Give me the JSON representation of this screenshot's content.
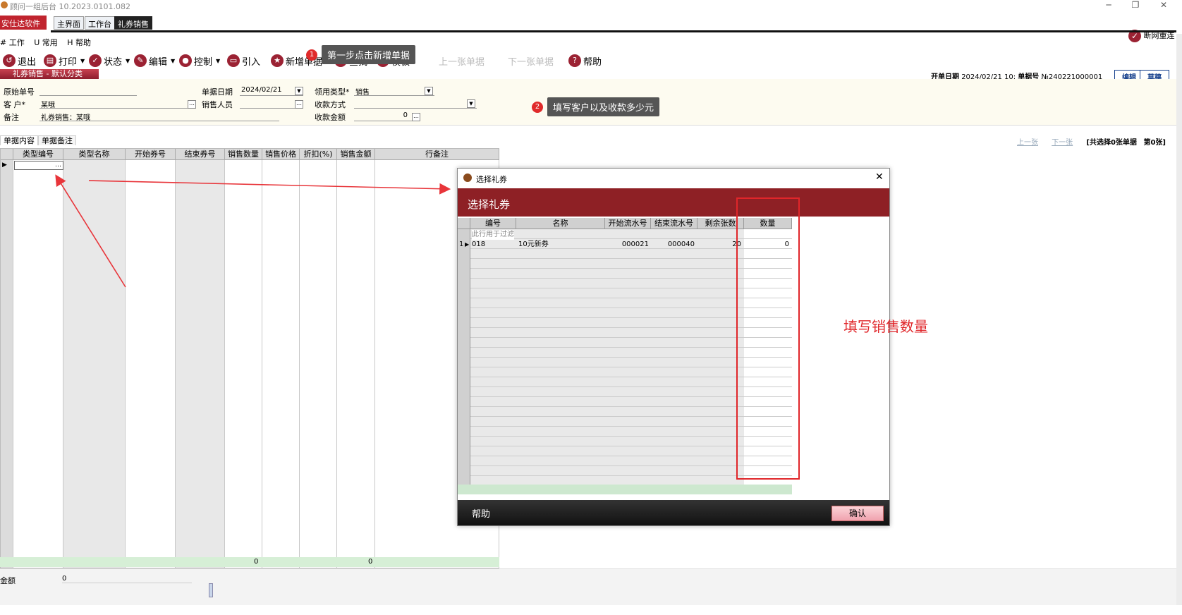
{
  "window": {
    "title": "顾问一组后台  10.2023.0101.082",
    "min": "─",
    "max": "❐",
    "close": "✕"
  },
  "tabs": {
    "brand": "安仕达软件",
    "items": [
      "主界面",
      "工作台",
      "礼券销售"
    ],
    "reconnect": "断网重连"
  },
  "menu": [
    "# 工作",
    "U 常用",
    "H 帮助"
  ],
  "toolbar": {
    "exit": "退出",
    "print": "打印",
    "status": "状态",
    "edit": "编辑",
    "control": "控制",
    "import": "引入",
    "new": "新增单据",
    "find": "查找",
    "template": "模板",
    "prev": "上一张单据",
    "next": "下一张单据",
    "help": "帮助"
  },
  "annotations": {
    "step1_num": "1",
    "step1": "第一步点击新增单据",
    "step2_num": "2",
    "step2": "填写客户以及收款多少元",
    "step3": "填写销售数量"
  },
  "module": {
    "title": "礼券销售 - 默认分类"
  },
  "header": {
    "date_label": "开单日期",
    "date": "2024/02/21 10:",
    "no_label": "单据号",
    "no": "№240221000001",
    "edit_btn": "编辑",
    "draft_btn": "草稿"
  },
  "form": {
    "orig_no_label": "原始单号",
    "orig_no": "",
    "customer_label": "客  户*",
    "customer": "某哦",
    "remark_label": "备注",
    "remark": "礼券销售：某哦",
    "date_label": "单据日期",
    "date": "2024/02/21",
    "seller_label": "销售人员",
    "seller": "",
    "type_label": "领用类型*",
    "type": "销售",
    "pay_label": "收款方式",
    "pay": "",
    "amount_label": "收款金额",
    "amount": "0"
  },
  "subtabs": [
    "单据内容",
    "单据备注"
  ],
  "nav": {
    "prev": "上一张",
    "next": "下一张",
    "selected": "[共选择0张单据",
    "page": "第0张]"
  },
  "grid": {
    "columns": [
      "类型编号",
      "类型名称",
      "开始券号",
      "结束券号",
      "销售数量",
      "销售价格",
      "折扣(%)",
      "销售金额",
      "行备注"
    ],
    "footer_qty": "0",
    "footer_amount": "0"
  },
  "bottom": {
    "amount_label": "金额",
    "amount": "0"
  },
  "dialog": {
    "title": "选择礼券",
    "header": "选择礼券",
    "columns": [
      "编号",
      "名称",
      "开始流水号",
      "结束流水号",
      "剩余张数",
      "数量"
    ],
    "filter_hint": "此行用于过滤",
    "rows": [
      {
        "idx": "1",
        "code": "018",
        "name": "10元新券",
        "start": "000021",
        "end": "000040",
        "remain": "20",
        "qty": "0"
      }
    ],
    "help": "帮助",
    "ok": "确认"
  }
}
